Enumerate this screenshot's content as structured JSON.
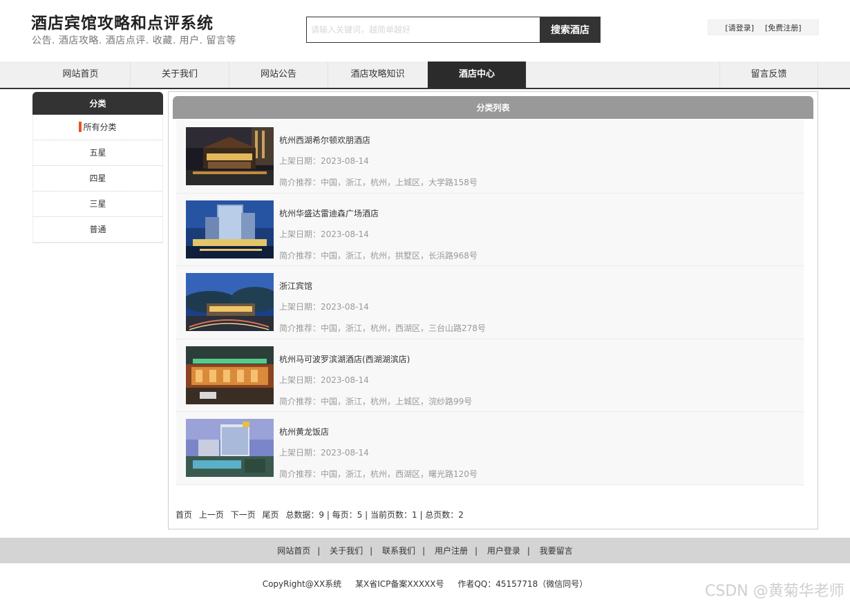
{
  "header": {
    "title": "酒店宾馆攻略和点评系统",
    "subtitle": "公告. 酒店攻略. 酒店点评. 收藏. 用户. 留言等",
    "search": {
      "placeholder": "请输入关键词，越简单越好",
      "button_label": "搜索酒店"
    },
    "login_label": "[请登录]",
    "register_label": "[免费注册]"
  },
  "nav": {
    "items": [
      {
        "label": "网站首页"
      },
      {
        "label": "关于我们"
      },
      {
        "label": "网站公告"
      },
      {
        "label": "酒店攻略知识"
      },
      {
        "label": "酒店中心"
      },
      {
        "label": "留言反馈"
      }
    ],
    "active": "酒店中心"
  },
  "sidebar": {
    "title": "分类",
    "items": [
      {
        "label": "所有分类"
      },
      {
        "label": "五星"
      },
      {
        "label": "四星"
      },
      {
        "label": "三星"
      },
      {
        "label": "普通"
      }
    ]
  },
  "main": {
    "title": "分类列表",
    "hotels": [
      {
        "name": "杭州西湖希尔顿欢朋酒店",
        "date": "上架日期：2023-08-14",
        "intro": "简介推荐：中国，浙江，杭州，上城区，大学路158号",
        "image": "hotel-night-facade"
      },
      {
        "name": "杭州华盛达雷迪森广场酒店",
        "date": "上架日期：2023-08-14",
        "intro": "简介推荐：中国，浙江，杭州，拱墅区，长浜路968号",
        "image": "hotel-towers-dusk"
      },
      {
        "name": "浙江宾馆",
        "date": "上架日期：2023-08-14",
        "intro": "简介推荐：中国，浙江，杭州，西湖区，三台山路278号",
        "image": "hotel-hillside-night"
      },
      {
        "name": "杭州马可波罗滨湖酒店(西湖湖滨店)",
        "date": "上架日期：2023-08-14",
        "intro": "简介推荐：中国，浙江，杭州，上城区，浣纱路99号",
        "image": "hotel-entrance-lights"
      },
      {
        "name": "杭州黄龙饭店",
        "date": "上架日期：2023-08-14",
        "intro": "简介推荐：中国，浙江，杭州，西湖区，曙光路120号",
        "image": "hotel-garden-pool"
      }
    ],
    "pager": {
      "first": "首页",
      "prev": "上一页",
      "next": "下一页",
      "last": "尾页",
      "info": "总数据：9 | 每页：5 | 当前页数：1 | 总页数：2"
    }
  },
  "footer": {
    "links": [
      {
        "label": "网站首页"
      },
      {
        "label": "关于我们"
      },
      {
        "label": "联系我们"
      },
      {
        "label": "用户注册"
      },
      {
        "label": "用户登录"
      },
      {
        "label": "我要留言"
      }
    ],
    "copyright": "CopyRight@XX系统",
    "icp": "某X省ICP备案XXXXX号",
    "author": "作者QQ：45157718（微信同号）",
    "watermark": "CSDN @黄菊华老师"
  },
  "colors": {
    "nav_active_bg": "#2b2b2b",
    "sidebar_head_bg": "#333333",
    "main_head_bg": "#999999",
    "active_marker": "#e8541e",
    "footer_bg": "#d4d4d4"
  }
}
